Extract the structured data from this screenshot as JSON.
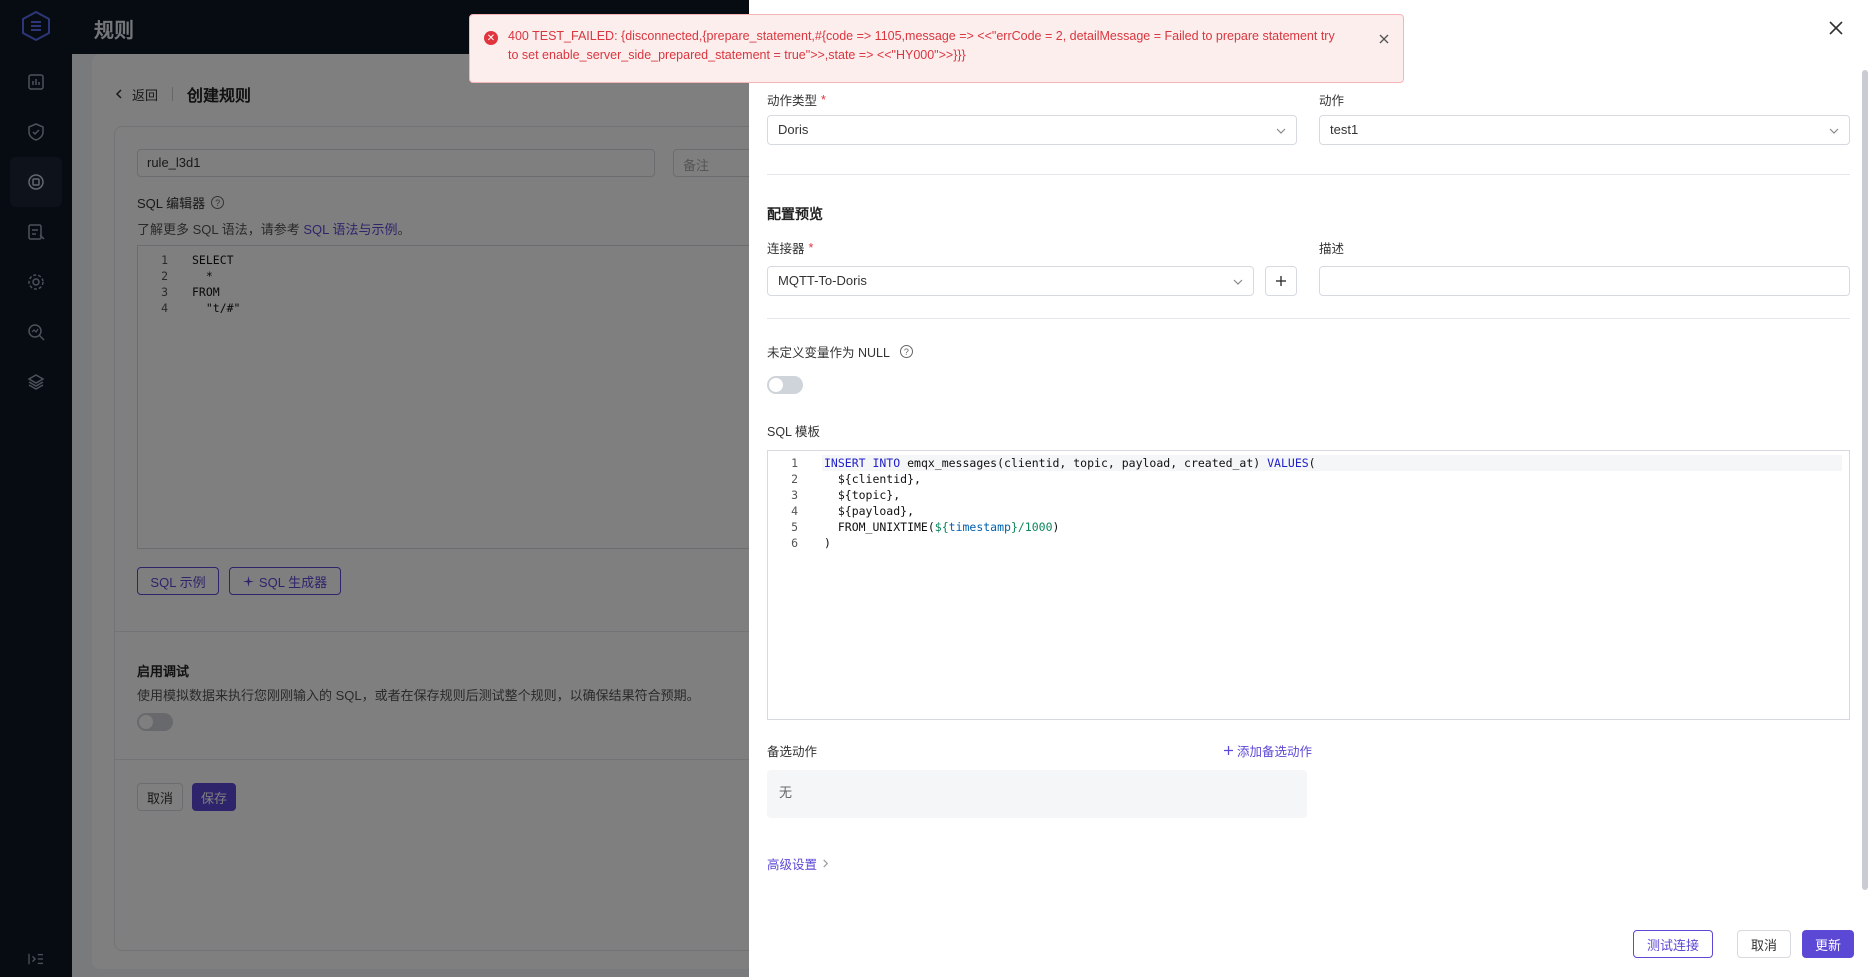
{
  "header": {
    "title": "规则"
  },
  "rail": {
    "items": [
      "dashboard-icon",
      "shield-check-icon",
      "rules-icon",
      "data-list-icon",
      "gear-icon",
      "search-analytics-icon",
      "layers-icon"
    ],
    "active_index": 2
  },
  "page": {
    "back_label": "返回",
    "title": "创建规则",
    "rule_name_value": "rule_l3d1",
    "note_placeholder": "备注",
    "sql_editor_label": "SQL 编辑器",
    "sql_hint_prefix": "了解更多 SQL 语法，请参考 ",
    "sql_hint_link": "SQL 语法与示例",
    "sql_hint_suffix": "。",
    "sql_lines": [
      {
        "num": "1",
        "text": "SELECT"
      },
      {
        "num": "2",
        "text": "  *"
      },
      {
        "num": "3",
        "text": "FROM"
      },
      {
        "num": "4",
        "text": "  \"t/#\""
      }
    ],
    "sql_example_button": "SQL 示例",
    "sql_generator_button": "SQL 生成器",
    "debug_title": "启用调试",
    "debug_desc": "使用模拟数据来执行您刚刚输入的 SQL，或者在保存规则后测试整个规则，以确保结果符合预期。",
    "cancel_button": "取消",
    "save_button": "保存"
  },
  "drawer": {
    "action_type_label": "动作类型",
    "action_type_value": "Doris",
    "action_label": "动作",
    "action_value": "test1",
    "preview_title": "配置预览",
    "connector_label": "连接器",
    "connector_value": "MQTT-To-Doris",
    "description_label": "描述",
    "description_value": "",
    "undefined_null_label": "未定义变量作为 NULL",
    "sql_template_label": "SQL 模板",
    "sql_template_lines": [
      {
        "num": "1",
        "text": "INSERT INTO emqx_messages(clientid, topic, payload, created_at) VALUES("
      },
      {
        "num": "2",
        "text": "  ${clientid},"
      },
      {
        "num": "3",
        "text": "  ${topic},"
      },
      {
        "num": "4",
        "text": "  ${payload},"
      },
      {
        "num": "5",
        "text": "  FROM_UNIXTIME(${timestamp}/1000)"
      },
      {
        "num": "6",
        "text": ")"
      }
    ],
    "fallback_label": "备选动作",
    "add_fallback_link": "添加备选动作",
    "fallback_empty": "无",
    "advanced_link": "高级设置",
    "test_connection_button": "测试连接",
    "cancel_button": "取消",
    "update_button": "更新"
  },
  "toast": {
    "message": "400 TEST_FAILED: {disconnected,{prepare_statement,#{code => 1105,message => <<\"errCode = 2, detailMessage = Failed to prepare statement try to set enable_server_side_prepared_statement = true\">>,state => <<\"HY000\">>}}}"
  },
  "colors": {
    "accent": "#5b49d6",
    "error": "#e0353d",
    "rail_bg": "#0f1625"
  }
}
